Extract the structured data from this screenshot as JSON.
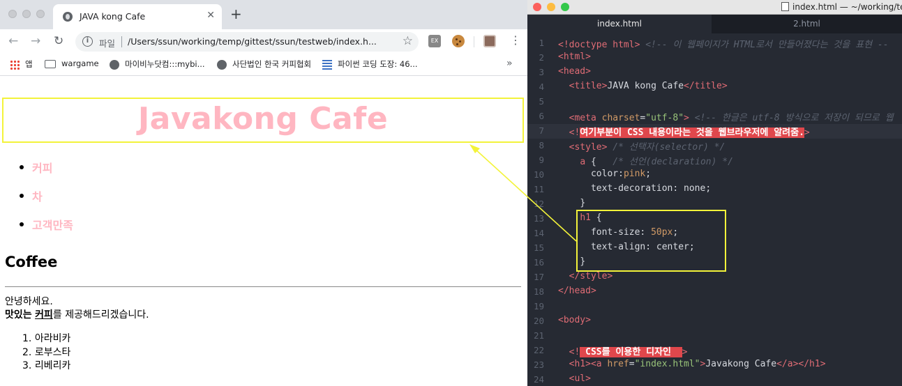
{
  "browser": {
    "tab_title": "JAVA kong Cafe",
    "tab_close": "✕",
    "new_tab": "+",
    "nav_back": "←",
    "nav_forward": "→",
    "nav_reload": "↻",
    "info_icon": "i",
    "url_scheme": "파일",
    "url": "/Users/ssun/working/temp/gittest/ssun/testweb/index.h...",
    "star": "☆",
    "ext1_label": "EX",
    "menu": "⋮",
    "bookmarks": [
      {
        "label": "앱",
        "icon": "apps-icon"
      },
      {
        "label": "wargame",
        "icon": "folder-icon"
      },
      {
        "label": "마이비누닷컴:::mybi...",
        "icon": "globe-icon"
      },
      {
        "label": "사단법인 한국 커피협회",
        "icon": "globe-icon"
      },
      {
        "label": "파이썬 코딩 도장: 46...",
        "icon": "python-icon"
      }
    ],
    "bookmarks_more": "»"
  },
  "page": {
    "h1": "Javakong Cafe",
    "nav": [
      "커피",
      "차",
      "고객만족"
    ],
    "h2": "Coffee",
    "greeting": "안녕하세요.",
    "line2_bold": "맛있는",
    "line2_link": "커피",
    "line2_rest": "를 제공해드리겠습니다.",
    "ordered": [
      "아라비카",
      "로부스타",
      "리베리카"
    ],
    "ordered_markers": [
      "1.",
      "2.",
      "3."
    ]
  },
  "editor": {
    "window_title": "index.html — ~/working/te",
    "tabs": [
      {
        "label": "index.html",
        "active": true
      },
      {
        "label": "2.html",
        "active": false
      }
    ],
    "line_numbers": [
      "1",
      "2",
      "3",
      "4",
      "5",
      "6",
      "7",
      "8",
      "9",
      "10",
      "11",
      "12",
      "13",
      "14",
      "15",
      "16",
      "17",
      "18",
      "19",
      "20",
      "21",
      "22",
      "23",
      "24"
    ],
    "code": {
      "l1_tag": "<!doctype html>",
      "l1_comment": " <!-- 이 웹페이지가 HTML로서 만들어졌다는 것을 표현 --",
      "l2": "<html>",
      "l3": "<head>",
      "l4_open": "<title>",
      "l4_text": "JAVA kong Cafe",
      "l4_close": "</title>",
      "l6_tag": "<meta",
      "l6_attr": " charset",
      "l6_eq": "=",
      "l6_val": "\"utf-8\"",
      "l6_end": ">",
      "l6_comment": " <!-- 한글은 utf-8 방식으로 저장이 되므로 웹",
      "l7_open": "<!",
      "l7_mark": "여기부분이 CSS 내용이라는 것을 웹브라우저에 알려줌.",
      "l7_close": ">",
      "l8_tag": "<style>",
      "l8_comment": " /* 선택자(selector) */",
      "l9_sel": "a",
      "l9_brace": " {",
      "l9_comment": "   /* 선언(declaration) */",
      "l10_prop": "color:",
      "l10_val": "pink",
      "l10_semi": ";",
      "l11": "text-decoration: none;",
      "l12": "}",
      "l13_sel": "h1",
      "l13_brace": " {",
      "l14_prop": "font-size: ",
      "l14_val": "50px",
      "l14_semi": ";",
      "l15": "text-align: center;",
      "l16": "}",
      "l17": "</style>",
      "l18": "</head>",
      "l20": "<body>",
      "l22_open": "<!",
      "l22_mark": " CSS를 이용한 디자인  ",
      "l22_close": ">",
      "l23_h1": "<h1>",
      "l23_a": "<a",
      "l23_attr": " href",
      "l23_eq": "=",
      "l23_val": "\"index.html\"",
      "l23_gt": ">",
      "l23_text": "Javakong Cafe",
      "l23_close": "</a></h1>",
      "l24": "<ul>"
    }
  },
  "colors": {
    "link_pink": "#ffb6c1",
    "highlight_yellow": "#f3f33a",
    "editor_bg": "#262a33",
    "mark_red": "#e0474c"
  }
}
